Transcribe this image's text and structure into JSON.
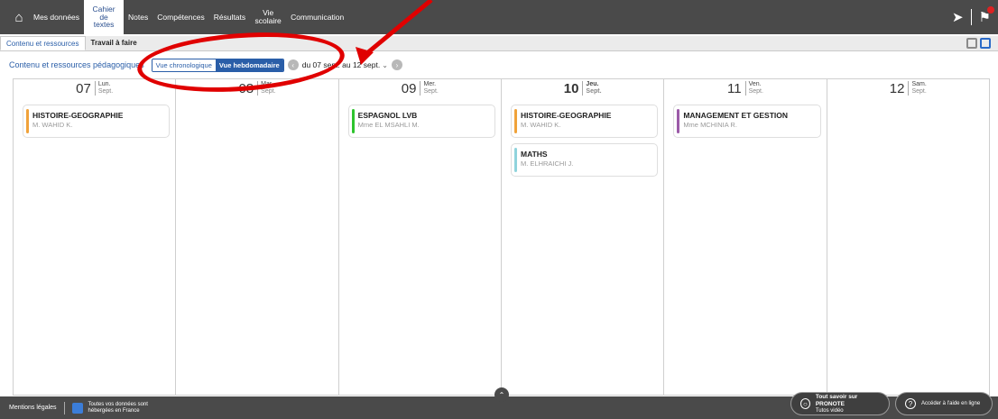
{
  "nav": {
    "items": [
      {
        "label": "Mes données"
      },
      {
        "label": "Cahier de textes",
        "active": true
      },
      {
        "label": "Notes"
      },
      {
        "label": "Compétences"
      },
      {
        "label": "Résultats"
      },
      {
        "label": "Vie scolaire"
      },
      {
        "label": "Communication"
      }
    ],
    "icons": [
      "home-icon",
      "send-icon",
      "notification-icon"
    ]
  },
  "tabs": [
    {
      "label": "Contenu et ressources",
      "active": true
    },
    {
      "label": "Travail à faire",
      "active": false
    }
  ],
  "toolbar": {
    "title": "Contenu et ressources pédagogiques",
    "view_chrono": "Vue chronologique",
    "view_weekly": "Vue hebdomadaire",
    "date_range": "du 07 sept. au 12 sept."
  },
  "days": [
    {
      "num": "07",
      "name": "Lun.",
      "month": "Sept.",
      "entries": [
        {
          "subject": "HISTOIRE-GEOGRAPHIE",
          "teacher": "M. WAHID K.",
          "color": "#f0a23a"
        }
      ]
    },
    {
      "num": "08",
      "name": "Mar.",
      "month": "Sept.",
      "entries": []
    },
    {
      "num": "09",
      "name": "Mer.",
      "month": "Sept.",
      "entries": [
        {
          "subject": "ESPAGNOL LVB",
          "teacher": "Mme EL MSAHLI M.",
          "color": "#2ec42e"
        }
      ]
    },
    {
      "num": "10",
      "name": "Jeu.",
      "month": "Sept.",
      "today": true,
      "entries": [
        {
          "subject": "HISTOIRE-GEOGRAPHIE",
          "teacher": "M. WAHID K.",
          "color": "#f0a23a"
        },
        {
          "subject": "MATHS",
          "teacher": "M. ELHRAICHI J.",
          "color": "#8fd3dc"
        }
      ]
    },
    {
      "num": "11",
      "name": "Ven.",
      "month": "Sept.",
      "entries": [
        {
          "subject": "MANAGEMENT ET GESTION",
          "teacher": "Mme MCHINIA R.",
          "color": "#9b5aa8"
        }
      ]
    },
    {
      "num": "12",
      "name": "Sam.",
      "month": "Sept.",
      "entries": []
    }
  ],
  "footer": {
    "mentions": "Mentions légales",
    "hosted_line1": "Toutes vos données sont",
    "hosted_line2": "hébergées en France",
    "pronote_title": "Tout savoir sur PRONOTE",
    "pronote_sub": "Tutos vidéo",
    "help": "Accéder à l'aide en ligne"
  },
  "colors": {
    "nav_bg": "#4a4a4a",
    "accent": "#2a5ea8",
    "annotation": "#e00000"
  }
}
